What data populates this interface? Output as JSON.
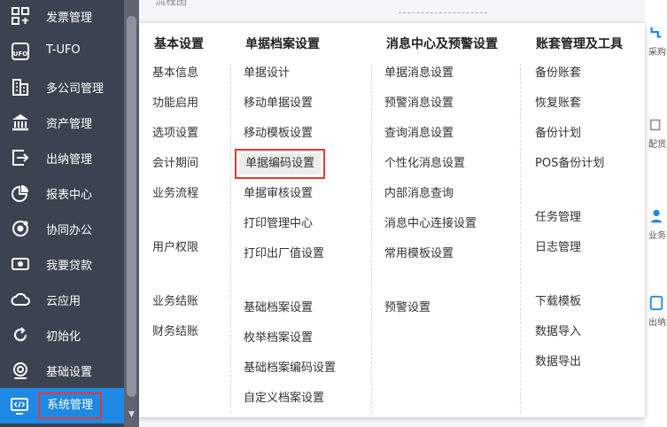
{
  "sidebar": {
    "items": [
      {
        "label": "发票管理",
        "icon": "invoice-grid-icon"
      },
      {
        "label": "T-UFO",
        "icon": "ufo-report-icon"
      },
      {
        "label": "多公司管理",
        "icon": "company-building-icon"
      },
      {
        "label": "资产管理",
        "icon": "bank-asset-icon"
      },
      {
        "label": "出纳管理",
        "icon": "cashier-export-icon"
      },
      {
        "label": "报表中心",
        "icon": "pie-chart-icon"
      },
      {
        "label": "协同办公",
        "icon": "collaboration-icon"
      },
      {
        "label": "我要贷款",
        "icon": "loan-cash-icon"
      },
      {
        "label": "云应用",
        "icon": "cloud-icon"
      },
      {
        "label": "初始化",
        "icon": "refresh-init-icon"
      },
      {
        "label": "基础设置",
        "icon": "gear-settings-icon"
      },
      {
        "label": "系统管理",
        "icon": "system-code-monitor-icon"
      }
    ],
    "active_index": 11
  },
  "background": {
    "top_fragment": "流程图",
    "right_items": [
      {
        "label": "采购",
        "icon": "purchase-flow-icon"
      },
      {
        "label": "配货",
        "icon": "distribution-icon"
      },
      {
        "label": "业务",
        "icon": "business-users-icon"
      },
      {
        "label": "出纳",
        "icon": "cashier-doc-icon"
      }
    ]
  },
  "menu": {
    "columns": [
      {
        "title": "基本设置",
        "items": [
          "基本信息",
          "功能启用",
          "选项设置",
          "会计期间",
          "业务流程",
          "用户权限",
          "业务结账",
          "财务结账"
        ]
      },
      {
        "title": "单据档案设置",
        "items": [
          "单据设计",
          "移动单据设置",
          "移动模板设置",
          "单据编码设置",
          "单据审核设置",
          "打印管理中心",
          "打印出厂值设置",
          "基础档案设置",
          "枚举档案设置",
          "基础档案编码设置",
          "自定义档案设置"
        ]
      },
      {
        "title": "消息中心及预警设置",
        "items": [
          "单据消息设置",
          "预警消息设置",
          "查询消息设置",
          "个性化消息设置",
          "内部消息查询",
          "消息中心连接设置",
          "常用模板设置",
          "预警设置"
        ]
      },
      {
        "title": "账套管理及工具",
        "items": [
          "备份账套",
          "恢复账套",
          "备份计划",
          "POS备份计划",
          "任务管理",
          "日志管理",
          "下载模板",
          "数据导入",
          "数据导出"
        ]
      }
    ],
    "selected_item": "单据编码设置"
  },
  "colors": {
    "sidebar_bg": "#3b4350",
    "active_bg": "#1e88e5",
    "highlight_border": "#e53935",
    "menu_bg": "#ffffff"
  }
}
